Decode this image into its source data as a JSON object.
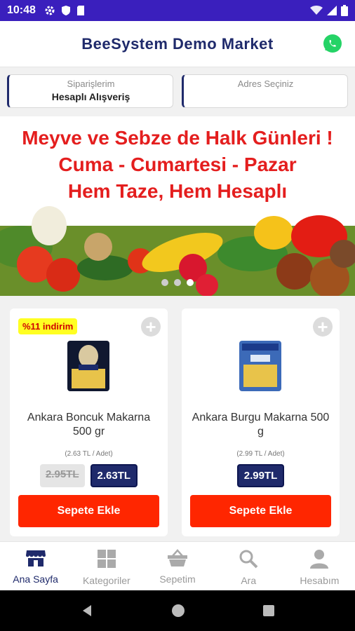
{
  "status_bar": {
    "time": "10:48"
  },
  "header": {
    "title": "BeeSystem Demo Market",
    "whatsapp_icon": "whatsapp-icon"
  },
  "selectors": {
    "orders": {
      "label": "Siparişlerim",
      "value": "Hesaplı Alışveriş"
    },
    "address": {
      "label": "Adres Seçiniz",
      "value": ""
    }
  },
  "banner": {
    "line1": "Meyve ve Sebze de Halk Günleri !",
    "line2": "Cuma - Cumartesi - Pazar",
    "line3": "Hem Taze, Hem Hesaplı",
    "slides": 3,
    "active_slide": 3
  },
  "products": [
    {
      "badge": "%11 indirim",
      "name": "Ankara Boncuk Makarna  500 gr",
      "unit_price": "(2.63 TL / Adet)",
      "old_price": "2.95TL",
      "price": "2.63TL",
      "add_label": "Sepete Ekle"
    },
    {
      "badge": "",
      "name": "Ankara Burgu Makarna 500 g",
      "unit_price": "(2.99 TL / Adet)",
      "old_price": "",
      "price": "2.99TL",
      "add_label": "Sepete Ekle"
    }
  ],
  "bottom_nav": [
    {
      "label": "Ana Sayfa",
      "icon": "store-icon",
      "active": true
    },
    {
      "label": "Kategoriler",
      "icon": "grid-icon",
      "active": false
    },
    {
      "label": "Sepetim",
      "icon": "basket-icon",
      "active": false
    },
    {
      "label": "Ara",
      "icon": "search-icon",
      "active": false
    },
    {
      "label": "Hesabım",
      "icon": "user-icon",
      "active": false
    }
  ],
  "colors": {
    "status_bar": "#3a1fbd",
    "brand": "#1f2a6b",
    "add_button": "#ff2600",
    "banner_text": "#e41e1e",
    "badge": "#ffff22"
  }
}
